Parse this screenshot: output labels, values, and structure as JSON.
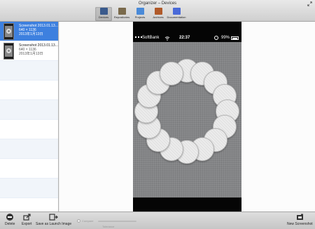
{
  "window": {
    "title": "Organizer – Devices"
  },
  "toolbar": {
    "items": [
      {
        "label": "Devices",
        "icon": "devices-icon",
        "color": "#3a5a8c",
        "selected": true
      },
      {
        "label": "Repositories",
        "icon": "repositories-icon",
        "color": "#7a6a4c",
        "selected": false
      },
      {
        "label": "Projects",
        "icon": "projects-icon",
        "color": "#4a8ad8",
        "selected": false
      },
      {
        "label": "Archives",
        "icon": "archives-icon",
        "color": "#b05a2a",
        "selected": false
      },
      {
        "label": "Documentation",
        "icon": "documentation-icon",
        "color": "#4a6ad8",
        "selected": false
      }
    ]
  },
  "sidebar": {
    "items": [
      {
        "title": "Screenshot 2013.01.13...",
        "size": "640 × 1136",
        "date": "2013年1月13日",
        "selected": true
      },
      {
        "title": "Screenshot 2013.01.13...",
        "size": "640 × 1136",
        "date": "2013年1月13日",
        "selected": false
      }
    ]
  },
  "preview": {
    "statusbar": {
      "carrier": "SoftBank",
      "time": "22:37",
      "battery": "99%",
      "battery_level": 0.99
    }
  },
  "bottombar": {
    "delete_label": "Delete",
    "export_label": "Export",
    "launch_label": "Save as Launch Image",
    "compare_label": "Compare",
    "tolerance_label": "Tolerance",
    "new_screenshot_label": "New Screenshot"
  },
  "colors": {
    "selection": "#3d80df",
    "screen_bg": "#848587",
    "circle": "#ececec"
  }
}
